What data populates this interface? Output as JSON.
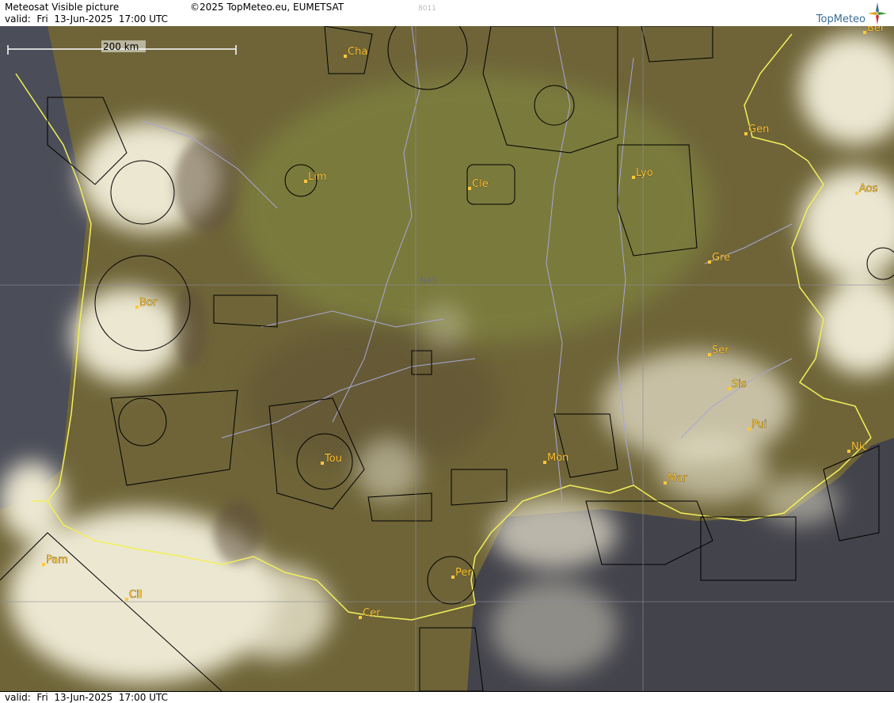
{
  "header": {
    "product": "Meteosat Visible picture",
    "copyright": "©2025 TopMeteo.eu, EUMETSAT",
    "code": "8011",
    "valid": "valid:  Fri  13-Jun-2025  17:00 UTC"
  },
  "footer": {
    "valid": "valid:  Fri  13-Jun-2025  17:00 UTC"
  },
  "logo": {
    "text": "TopMeteo",
    "icon": "compass-star-icon"
  },
  "map": {
    "scale_label": "200 km",
    "grid_label": "N45",
    "colors": {
      "land": "#6e6438",
      "sea": "#4a4a52",
      "cloud": "#ede8d2",
      "coast": "#f2f05a",
      "river": "#a9a6d6",
      "label": "#ffc83a"
    },
    "cities": [
      {
        "name": "Cha"
      },
      {
        "name": "Ber"
      },
      {
        "name": "Gen"
      },
      {
        "name": "Lim"
      },
      {
        "name": "Cle"
      },
      {
        "name": "Lyo"
      },
      {
        "name": "Aos"
      },
      {
        "name": "Gre"
      },
      {
        "name": "Bor"
      },
      {
        "name": "Ser"
      },
      {
        "name": "Sis"
      },
      {
        "name": "Pui"
      },
      {
        "name": "Nic"
      },
      {
        "name": "Tou"
      },
      {
        "name": "Mon"
      },
      {
        "name": "Mar"
      },
      {
        "name": "Pam"
      },
      {
        "name": "Per"
      },
      {
        "name": "Cil"
      },
      {
        "name": "Cer"
      }
    ]
  }
}
